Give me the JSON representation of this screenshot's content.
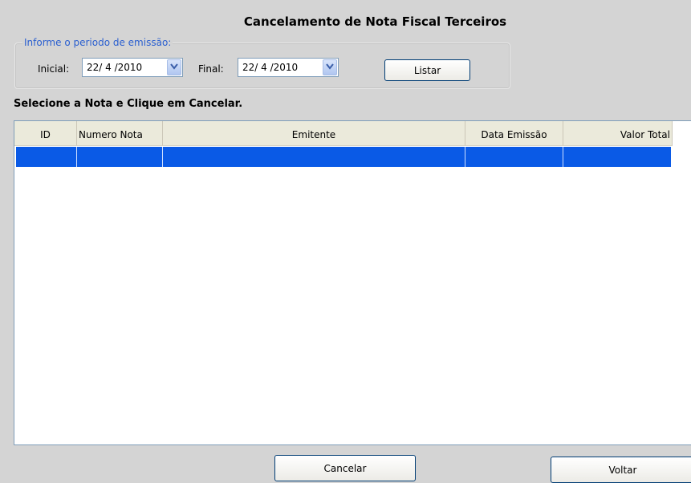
{
  "window": {
    "title": "Cancelamento de Nota Fiscal Terceiros"
  },
  "period": {
    "legend": "Informe o periodo de emissão:",
    "initial_label": "Inicial:",
    "initial_value": "22/ 4 /2010",
    "final_label": "Final:",
    "final_value": "22/ 4 /2010",
    "list_button": "Listar"
  },
  "instruction": "Selecione a Nota e Clique em Cancelar.",
  "grid": {
    "columns": [
      "ID",
      "Numero Nota",
      "Emitente",
      "Data Emissão",
      "Valor Total"
    ],
    "rows": [
      [
        "",
        "",
        "",
        "",
        ""
      ]
    ],
    "selected_color": "#0a5ae6"
  },
  "footer": {
    "cancel_button": "Cancelar",
    "back_button": "Voltar"
  }
}
